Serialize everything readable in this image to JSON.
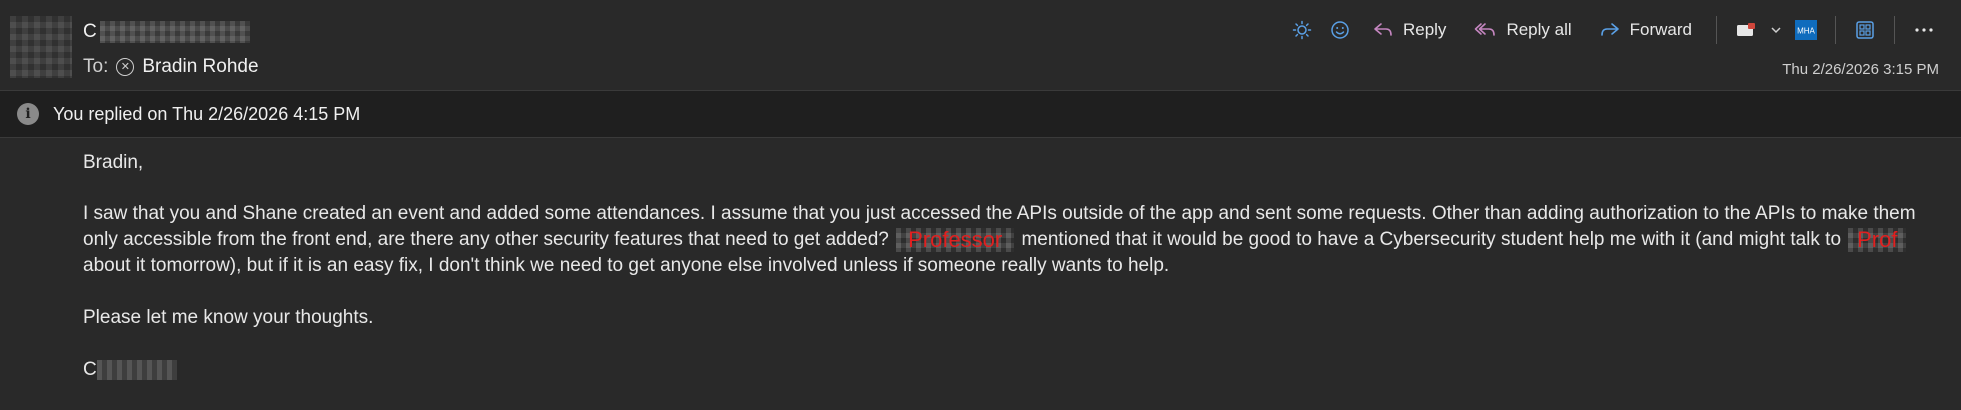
{
  "header": {
    "sender_initial": "C",
    "to_label": "To:",
    "recipient": "Bradin Rohde",
    "timestamp": "Thu 2/26/2026 3:15 PM"
  },
  "toolbar": {
    "reply_label": "Reply",
    "reply_all_label": "Reply all",
    "forward_label": "Forward",
    "addin_label": "MHA",
    "icons": [
      "brightness-icon",
      "emoji-icon",
      "reply-icon",
      "reply-all-icon",
      "forward-icon",
      "tag-icon",
      "chevron-down-icon",
      "addin-icon",
      "apps-icon",
      "more-icon"
    ],
    "accent_color": "#0f6cbd",
    "reply_icon_color": "#c586c0",
    "forward_icon_color": "#5aa0e6"
  },
  "banner": {
    "text": "You replied on Thu 2/26/2026 4:15 PM"
  },
  "message": {
    "greeting": "Bradin,",
    "para1_part1": "I saw that you and Shane created an event and added some attendances. I assume that you just accessed the APIs outside of the app and sent some requests. Other than adding authorization to the APIs to make them only accessible from the front end, are there any other security features that need to get added?",
    "redaction1": "Professor",
    "para1_part2": "mentioned that it would be good to have a Cybersecurity student help me with it (and might talk to",
    "redaction2": "Prof",
    "para1_part3": "about it tomorrow), but if it is an easy fix, I don't think we need to get anyone else involved unless if someone really wants to help.",
    "closing": "Please let me know your thoughts.",
    "signature_initial": "C"
  }
}
